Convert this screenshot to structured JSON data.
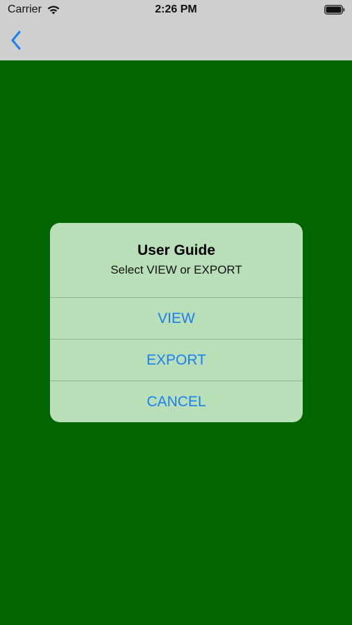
{
  "status_bar": {
    "carrier": "Carrier",
    "time": "2:26 PM",
    "wifi_icon": "wifi-icon",
    "battery_icon": "battery-full-icon"
  },
  "nav_bar": {
    "back_icon": "chevron-left-icon",
    "accent_color": "#1a7ff2"
  },
  "background_color": "#006400",
  "alert": {
    "title": "User Guide",
    "message": "Select VIEW or EXPORT",
    "actions": [
      {
        "label": "VIEW"
      },
      {
        "label": "EXPORT"
      },
      {
        "label": "CANCEL"
      }
    ],
    "background_color": "#b9dfb9",
    "action_color": "#1a7ff2"
  }
}
